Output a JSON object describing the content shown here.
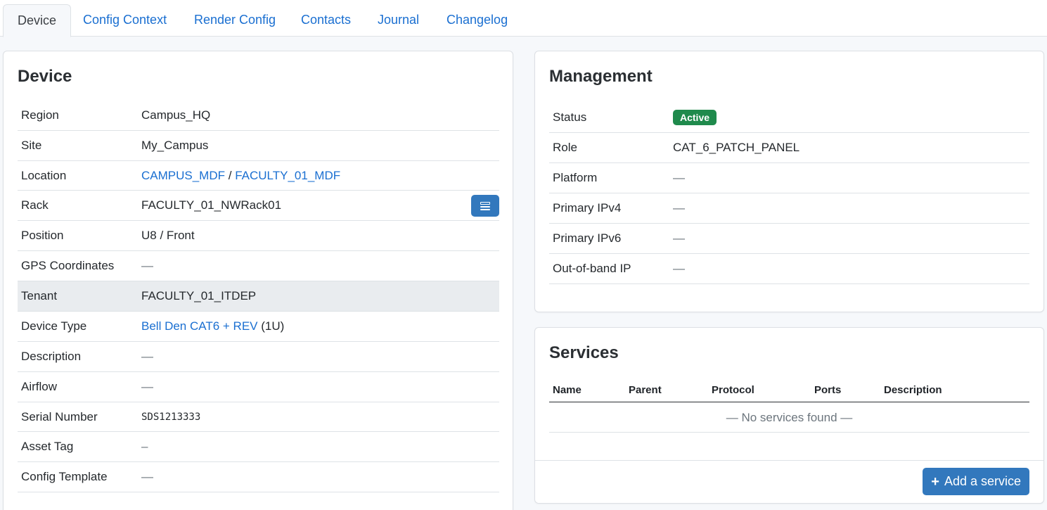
{
  "tabs": [
    {
      "label": "Device"
    },
    {
      "label": "Config Context"
    },
    {
      "label": "Render Config"
    },
    {
      "label": "Contacts"
    },
    {
      "label": "Journal"
    },
    {
      "label": "Changelog"
    }
  ],
  "device": {
    "title": "Device",
    "region": {
      "label": "Region",
      "value": "Campus_HQ"
    },
    "site": {
      "label": "Site",
      "value": "My_Campus"
    },
    "location": {
      "label": "Location",
      "parent": "CAMPUS_MDF",
      "separator": "/",
      "value": "FACULTY_01_MDF"
    },
    "rack": {
      "label": "Rack",
      "value": "FACULTY_01_NWRack01"
    },
    "position": {
      "label": "Position",
      "value": "U8 / Front"
    },
    "gps": {
      "label": "GPS Coordinates",
      "value": "—"
    },
    "tenant": {
      "label": "Tenant",
      "value": "FACULTY_01_ITDEP"
    },
    "device_type": {
      "label": "Device Type",
      "value": "Bell Den CAT6 + REV",
      "suffix": "(1U)"
    },
    "description": {
      "label": "Description",
      "value": "—"
    },
    "airflow": {
      "label": "Airflow",
      "value": "—"
    },
    "serial": {
      "label": "Serial Number",
      "value": "SDS1213333"
    },
    "asset_tag": {
      "label": "Asset Tag",
      "value": "–"
    },
    "config_template": {
      "label": "Config Template",
      "value": "—"
    }
  },
  "management": {
    "title": "Management",
    "status": {
      "label": "Status",
      "value": "Active"
    },
    "role": {
      "label": "Role",
      "value": "CAT_6_PATCH_PANEL"
    },
    "platform": {
      "label": "Platform",
      "value": "—"
    },
    "ipv4": {
      "label": "Primary IPv4",
      "value": "—"
    },
    "ipv6": {
      "label": "Primary IPv6",
      "value": "—"
    },
    "oob": {
      "label": "Out-of-band IP",
      "value": "—"
    }
  },
  "services": {
    "title": "Services",
    "columns": [
      "Name",
      "Parent",
      "Protocol",
      "Ports",
      "Description"
    ],
    "empty_text": "— No services found —",
    "add_label": "Add a service"
  },
  "colors": {
    "link": "#1a6fd1",
    "primary_button": "#3278bd",
    "status_active": "#1f8a4c"
  }
}
